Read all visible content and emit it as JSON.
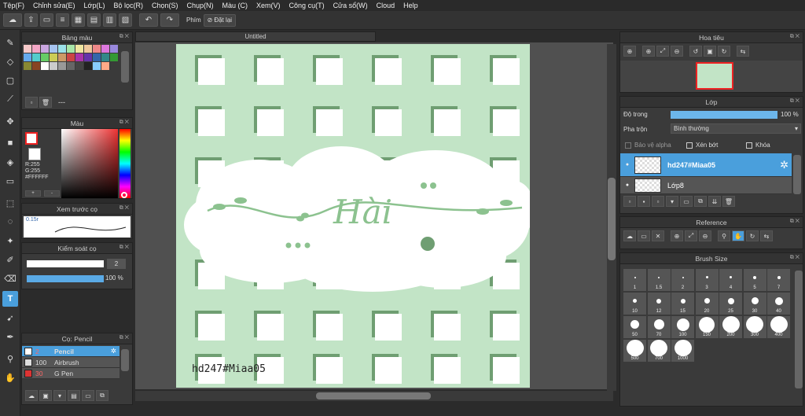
{
  "menu": [
    "Tệp(F)",
    "Chỉnh sửa(E)",
    "Lớp(L)",
    "Bộ lọc(R)",
    "Chọn(S)",
    "Chụp(N)",
    "Màu (C)",
    "Xem(V)",
    "Công cụ(T)",
    "Cửa sổ(W)",
    "Cloud",
    "Help"
  ],
  "toolbar": {
    "shortcut_label": "Phím",
    "reset_label": "Đặt lại"
  },
  "palette_panel": {
    "title": "Bảng màu",
    "footer": "---",
    "colors": [
      "#f6c9c9",
      "#f3a6c5",
      "#c9a6e0",
      "#a6c4f0",
      "#9be0e8",
      "#a8e6a8",
      "#f0e6a0",
      "#f0c89c",
      "#e88",
      "#d7d",
      "#98d",
      "#6ae",
      "#5cc",
      "#6c6",
      "#cc5",
      "#c96",
      "#c44",
      "#a3a",
      "#63a",
      "#36a",
      "#388",
      "#393",
      "#883",
      "#842",
      "#fff",
      "#ccc",
      "#999",
      "#666",
      "#444",
      "#222",
      "#8cf",
      "#fa8"
    ]
  },
  "color_panel": {
    "title": "Màu",
    "r": "R:255",
    "g": "G:255",
    "hex": "#FFFFFF",
    "plus": "+",
    "minus": "-"
  },
  "preview_panel": {
    "title": "Xem trước cọ",
    "size": "0.15r"
  },
  "brush_control": {
    "title": "Kiểm soát cọ",
    "size_value": "2",
    "opacity_value": "100 %",
    "opacity_level": 1.0
  },
  "brush_panel": {
    "title": "Cọ: Pencil",
    "items": [
      {
        "size": "2",
        "name": "Pencil",
        "selected": true,
        "swatch": "#fff"
      },
      {
        "size": "100",
        "name": "Airbrush",
        "selected": false,
        "swatch": "#ddd"
      },
      {
        "size": "30",
        "name": "G Pen",
        "selected": false,
        "swatch": "#d33"
      }
    ]
  },
  "document": {
    "tab": "Untitled",
    "main_text": "Hài",
    "watermark": "hd247#Miaa05"
  },
  "navigator": {
    "title": "Hoa tiêu"
  },
  "layer_panel": {
    "title": "Lớp",
    "opacity_label": "Độ trong",
    "opacity_value": "100 %",
    "opacity_level": 1.0,
    "blend_label": "Pha trộn",
    "blend_value": "Bình thường",
    "alpha_label": "Bảo vệ alpha",
    "clip_label": "Xén bớt",
    "lock_label": "Khóa",
    "layers": [
      {
        "name": "hd247#Miaa05",
        "selected": true
      },
      {
        "name": "Lớp8",
        "selected": false
      }
    ]
  },
  "reference_panel": {
    "title": "Reference"
  },
  "brush_size_panel": {
    "title": "Brush Size",
    "sizes": [
      "1",
      "1.5",
      "2",
      "3",
      "4",
      "5",
      "7",
      "10",
      "12",
      "15",
      "20",
      "25",
      "30",
      "40",
      "50",
      "70",
      "100",
      "150",
      "200",
      "300",
      "400",
      "500",
      "700",
      "1000"
    ]
  },
  "colors": {
    "accent": "#4a9fdc",
    "canvas_bg": "#c2e4c6",
    "pattern": "#6f9e72",
    "text_green": "#8cc28f"
  }
}
